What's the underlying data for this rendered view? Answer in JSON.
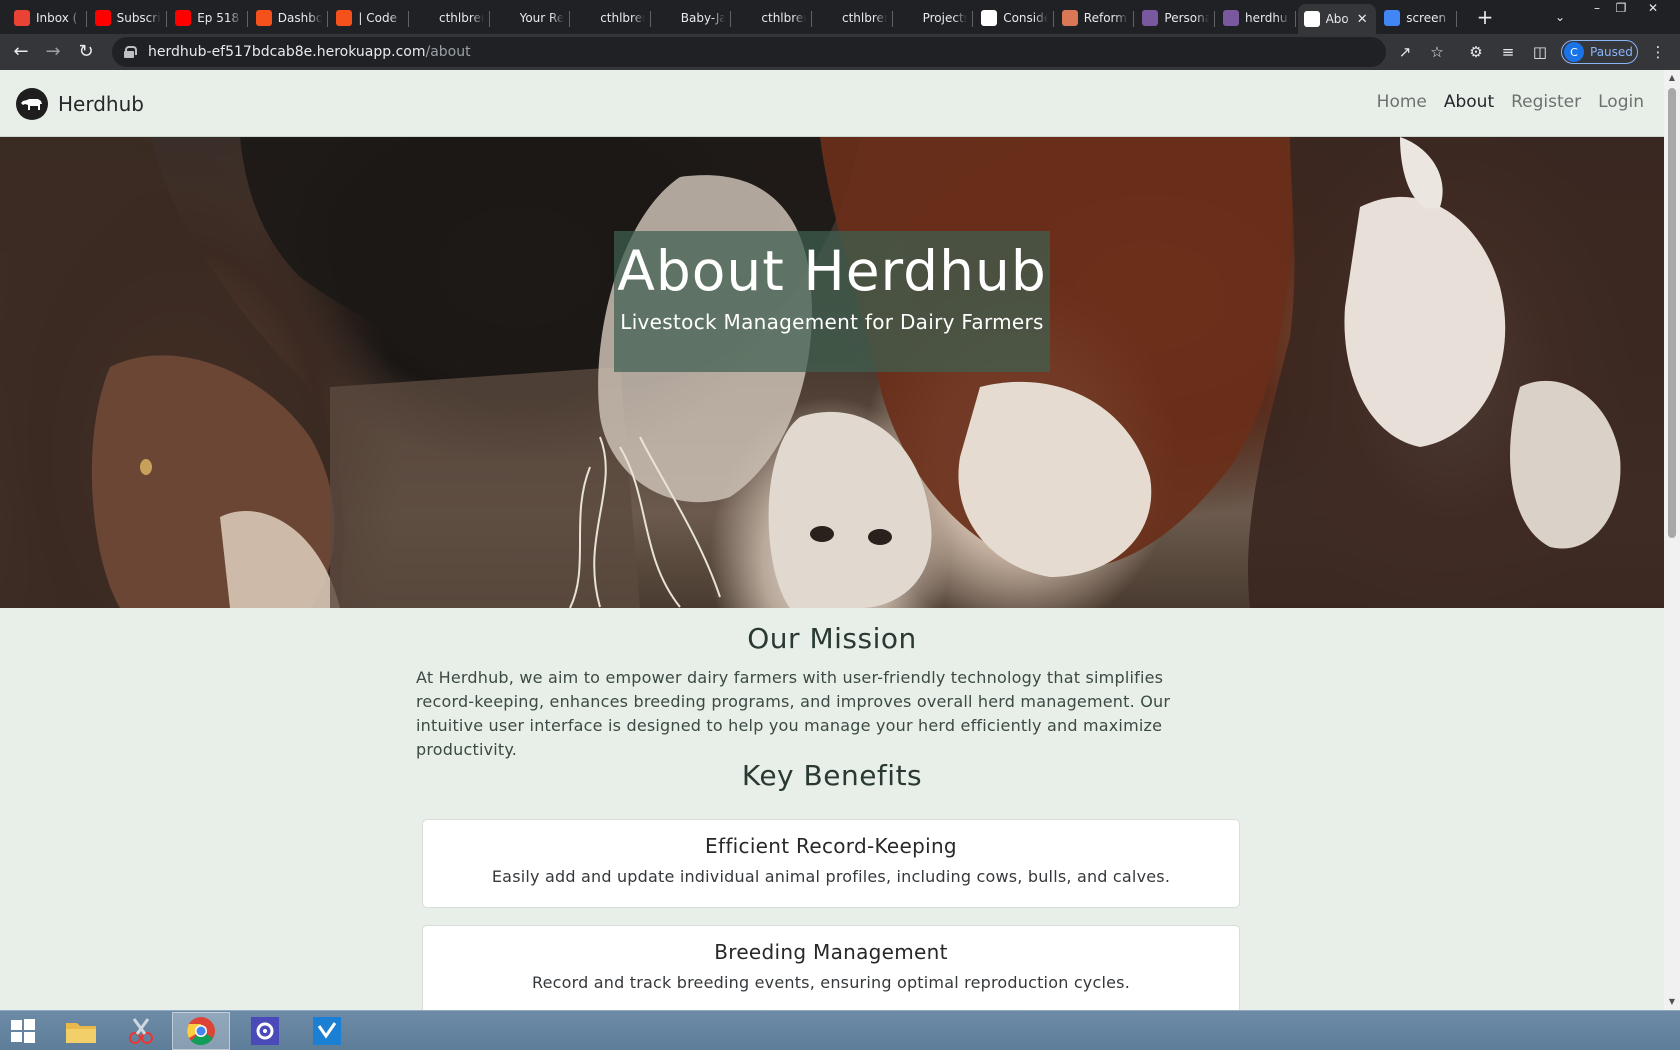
{
  "browser": {
    "tabs": [
      {
        "title": "Inbox (",
        "favicon": "gmail-icon",
        "color": "#ea4335"
      },
      {
        "title": "Subscri",
        "favicon": "youtube-icon",
        "color": "#ff0000"
      },
      {
        "title": "Ep 518",
        "favicon": "youtube-icon",
        "color": "#ff0000"
      },
      {
        "title": "Dashbo",
        "favicon": "circle-icon",
        "color": "#f5511d"
      },
      {
        "title": "| Code",
        "favicon": "circle-icon",
        "color": "#f5511d"
      },
      {
        "title": "cthlbrer",
        "favicon": "github-icon",
        "color": "#202124"
      },
      {
        "title": "Your Re",
        "favicon": "github-icon",
        "color": "#202124"
      },
      {
        "title": "cthlbrer",
        "favicon": "github-icon",
        "color": "#202124"
      },
      {
        "title": "Baby-Ja",
        "favicon": "github-icon",
        "color": "#202124"
      },
      {
        "title": "cthlbrer",
        "favicon": "github-icon",
        "color": "#202124"
      },
      {
        "title": "cthlbrer",
        "favicon": "github-icon",
        "color": "#202124"
      },
      {
        "title": "Projects",
        "favicon": "github-icon",
        "color": "#202124"
      },
      {
        "title": "Conside",
        "favicon": "openai-icon",
        "color": "#ffffff"
      },
      {
        "title": "Reform",
        "favicon": "sparkle-icon",
        "color": "#d97757"
      },
      {
        "title": "Persona",
        "favicon": "heroku-icon",
        "color": "#79589f"
      },
      {
        "title": "herdhu",
        "favicon": "heroku-icon",
        "color": "#79589f"
      },
      {
        "title": "Abo",
        "favicon": "herdhub-icon",
        "color": "#ffffff",
        "active": true
      },
      {
        "title": "screen",
        "favicon": "google-icon",
        "color": "#4285f4"
      }
    ],
    "url_host": "herdhub-ef517bdcab8e.herokuapp.com",
    "url_path": "/about",
    "profile_initial": "C",
    "profile_status": "Paused"
  },
  "site": {
    "brand": "Herdhub",
    "nav": [
      "Home",
      "About",
      "Register",
      "Login"
    ],
    "nav_active": "About"
  },
  "hero": {
    "title": "About Herdhub",
    "subtitle": "Livestock Management for Dairy Farmers"
  },
  "mission": {
    "heading": "Our Mission",
    "text": "At Herdhub, we aim to empower dairy farmers with user-friendly technology that simplifies record-keeping, enhances breeding programs, and improves overall herd management. Our intuitive user interface is designed to help you manage your herd efficiently and maximize productivity."
  },
  "benefits": {
    "heading": "Key Benefits",
    "items": [
      {
        "title": "Efficient Record-Keeping",
        "text": "Easily add and update individual animal profiles, including cows, bulls, and calves."
      },
      {
        "title": "Breeding Management",
        "text": "Record and track breeding events, ensuring optimal reproduction cycles."
      }
    ]
  },
  "taskbar": {
    "items": [
      "start-icon",
      "file-explorer-icon",
      "snipping-tool-icon",
      "chrome-icon",
      "settings-icon",
      "vscode-icon"
    ]
  },
  "colors": {
    "page_bg": "#e7efe8",
    "hero_overlay": "#3e5f50",
    "heading": "#2a3a33"
  }
}
